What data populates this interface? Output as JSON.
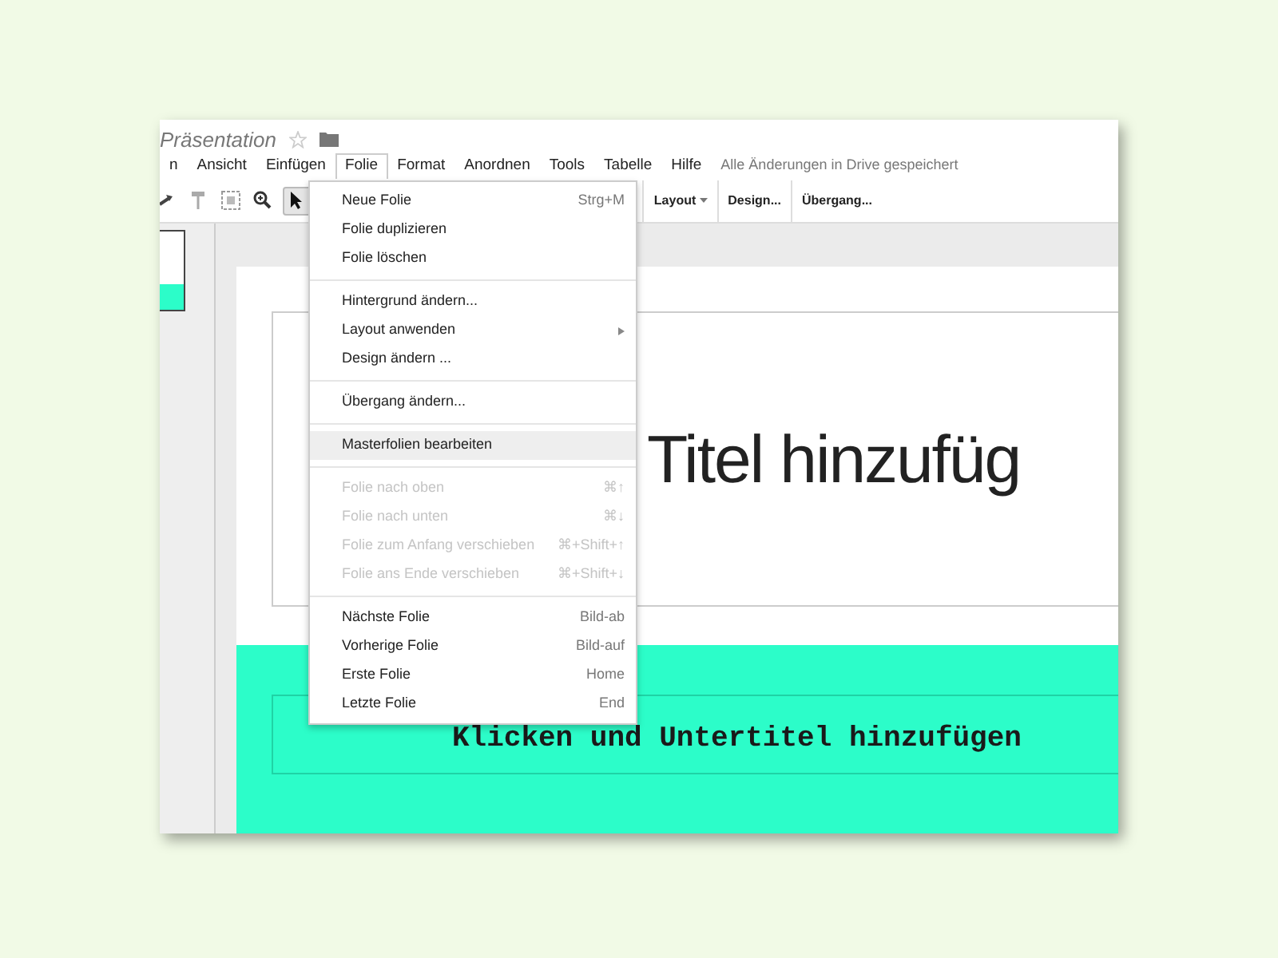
{
  "document": {
    "title": "Präsentation",
    "starred": false
  },
  "menu_bar": [
    {
      "label": "n",
      "selected": false
    },
    {
      "label": "Ansicht",
      "selected": false
    },
    {
      "label": "Einfügen",
      "selected": false
    },
    {
      "label": "Folie",
      "selected": true
    },
    {
      "label": "Format",
      "selected": false
    },
    {
      "label": "Anordnen",
      "selected": false
    },
    {
      "label": "Tools",
      "selected": false
    },
    {
      "label": "Tabelle",
      "selected": false
    },
    {
      "label": "Hilfe",
      "selected": false
    }
  ],
  "save_status": "Alle Änderungen in Drive gespeichert",
  "toolbar": {
    "tools": [
      {
        "kind": "redo",
        "selected": false
      },
      {
        "kind": "paint",
        "selected": false
      },
      {
        "kind": "fit",
        "selected": false
      },
      {
        "kind": "zoom",
        "selected": false
      },
      {
        "kind": "pointer",
        "selected": true
      }
    ],
    "buttons": [
      {
        "label": "Layout",
        "dropdown": true
      },
      {
        "label": "Design...",
        "dropdown": false
      },
      {
        "label": "Übergang...",
        "dropdown": false
      }
    ]
  },
  "dropdown_menu": [
    {
      "kind": "item",
      "label": "Neue Folie",
      "shortcut": "Strg+M",
      "disabled": false,
      "highlighted": false
    },
    {
      "kind": "item",
      "label": "Folie duplizieren",
      "disabled": false,
      "highlighted": false
    },
    {
      "kind": "item",
      "label": "Folie löschen",
      "disabled": false,
      "highlighted": false
    },
    {
      "kind": "separator"
    },
    {
      "kind": "item",
      "label": "Hintergrund ändern...",
      "disabled": false,
      "highlighted": false
    },
    {
      "kind": "item",
      "label": "Layout anwenden",
      "submenu": true,
      "disabled": false,
      "highlighted": false
    },
    {
      "kind": "item",
      "label": "Design ändern ...",
      "disabled": false,
      "highlighted": false
    },
    {
      "kind": "separator"
    },
    {
      "kind": "item",
      "label": "Übergang ändern...",
      "disabled": false,
      "highlighted": false
    },
    {
      "kind": "separator"
    },
    {
      "kind": "item",
      "label": "Masterfolien bearbeiten",
      "disabled": false,
      "highlighted": true
    },
    {
      "kind": "separator"
    },
    {
      "kind": "item",
      "label": "Folie nach oben",
      "shortcut": "⌘↑",
      "disabled": true,
      "highlighted": false
    },
    {
      "kind": "item",
      "label": "Folie nach unten",
      "shortcut": "⌘↓",
      "disabled": true,
      "highlighted": false
    },
    {
      "kind": "item",
      "label": "Folie zum Anfang verschieben",
      "shortcut": "⌘+Shift+↑",
      "disabled": true,
      "highlighted": false
    },
    {
      "kind": "item",
      "label": "Folie ans Ende verschieben",
      "shortcut": "⌘+Shift+↓",
      "disabled": true,
      "highlighted": false
    },
    {
      "kind": "separator"
    },
    {
      "kind": "item",
      "label": "Nächste Folie",
      "shortcut": "Bild-ab",
      "disabled": false,
      "highlighted": false
    },
    {
      "kind": "item",
      "label": "Vorherige Folie",
      "shortcut": "Bild-auf",
      "disabled": false,
      "highlighted": false
    },
    {
      "kind": "item",
      "label": "Erste Folie",
      "shortcut": "Home",
      "disabled": false,
      "highlighted": false
    },
    {
      "kind": "item",
      "label": "Letzte Folie",
      "shortcut": "End",
      "disabled": false,
      "highlighted": false
    }
  ],
  "slide": {
    "title": "Titel hinzufüg",
    "subtitle": "Klicken und Untertitel hinzufügen"
  }
}
